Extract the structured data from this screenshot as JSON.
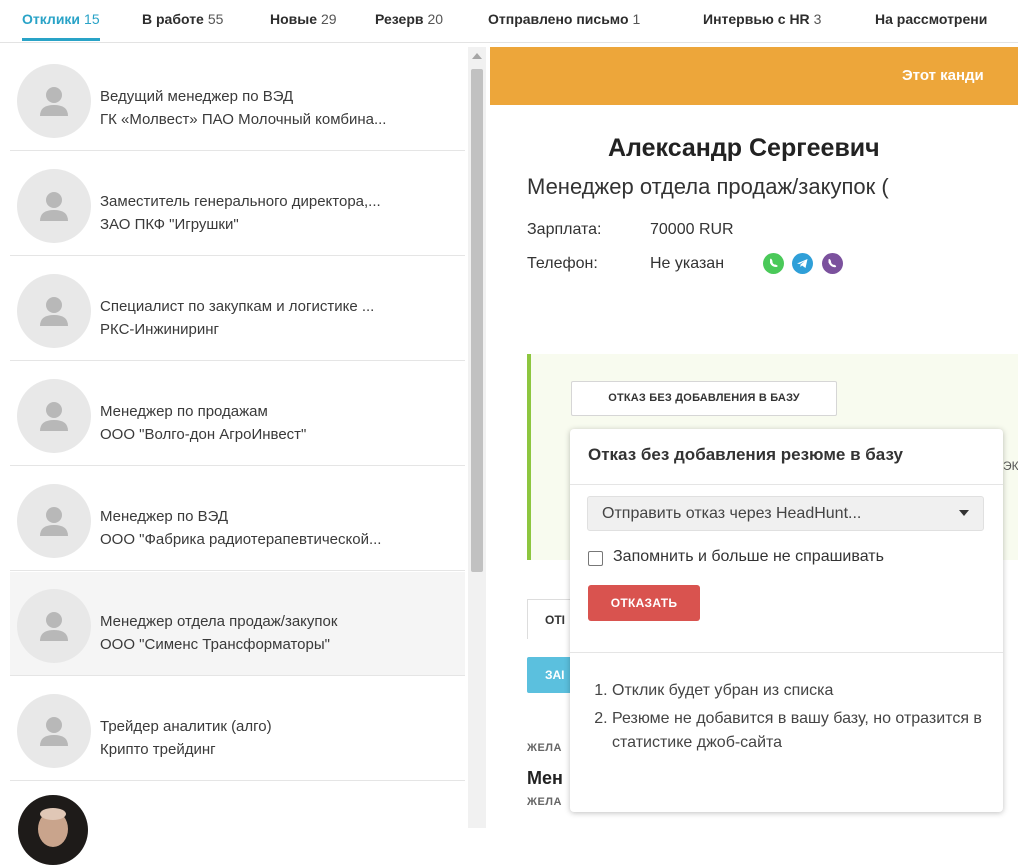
{
  "tabs": [
    {
      "label": "Отклики",
      "count": "15",
      "active": true
    },
    {
      "label": "В работе",
      "count": "55"
    },
    {
      "label": "Новые",
      "count": "29"
    },
    {
      "label": "Резерв",
      "count": "20"
    },
    {
      "label": "Отправлено письмо",
      "count": "1"
    },
    {
      "label": "Интервью с HR",
      "count": "3"
    },
    {
      "label": "На рассмотрени",
      "count": ""
    }
  ],
  "candidates": [
    {
      "title": "Ведущий менеджер по ВЭД",
      "company": "ГК «Молвест» ПАО Молочный комбина..."
    },
    {
      "title": "Заместитель генерального директора,...",
      "company": "ЗАО ПКФ \"Игрушки\""
    },
    {
      "title": "Специалист по закупкам и логистике ...",
      "company": "РКС-Инжиниринг"
    },
    {
      "title": "Менеджер по продажам",
      "company": "ООО \"Волго-дон АгроИнвест\""
    },
    {
      "title": "Менеджер по ВЭД",
      "company": "ООО \"Фабрика радиотерапевтической..."
    },
    {
      "title": "Менеджер отдела продаж/закупок",
      "company": "ООО \"Сименс Трансформаторы\"",
      "selected": true
    },
    {
      "title": "Трейдер аналитик (алго)",
      "company": "Крипто трейдинг"
    }
  ],
  "detail": {
    "banner": "Этот канди",
    "name": "Александр Сергеевич",
    "position": "Менеджер отдела продаж/закупок (",
    "salary_label": "Зарплата:",
    "salary_value": "70000 RUR",
    "phone_label": "Телефон:",
    "phone_value": "Не указан",
    "messengers": [
      "whatsapp-icon",
      "telegram-icon",
      "viber-icon"
    ],
    "reject_no_db_button": "ОТКАЗ БЕЗ ДОБАВЛЕНИЯ В БАЗУ",
    "tab_stub": "ОТІ",
    "blue_stub": "ЗАІ",
    "label_1": "ЖЕЛА",
    "bold_stub": "Мен",
    "label_2": "ЖЕЛА",
    "bg_fragment": "ЭК"
  },
  "popover": {
    "title": "Отказ без добавления резюме в базу",
    "select_value": "Отправить отказ через HeadHunt...",
    "checkbox_label": "Запомнить и больше не спрашивать",
    "reject_button": "ОТКАЗАТЬ",
    "notes": [
      "Отклик будет убран из списка",
      "Резюме не добавится в вашу базу, но отразится в статистике джоб-сайта"
    ]
  },
  "colors": {
    "accent": "#29a3c7",
    "banner": "#eda63a",
    "danger": "#d9534f",
    "success_border": "#8dc63f",
    "whatsapp": "#4ac959",
    "telegram": "#2f9fd8",
    "viber": "#7b519d"
  }
}
